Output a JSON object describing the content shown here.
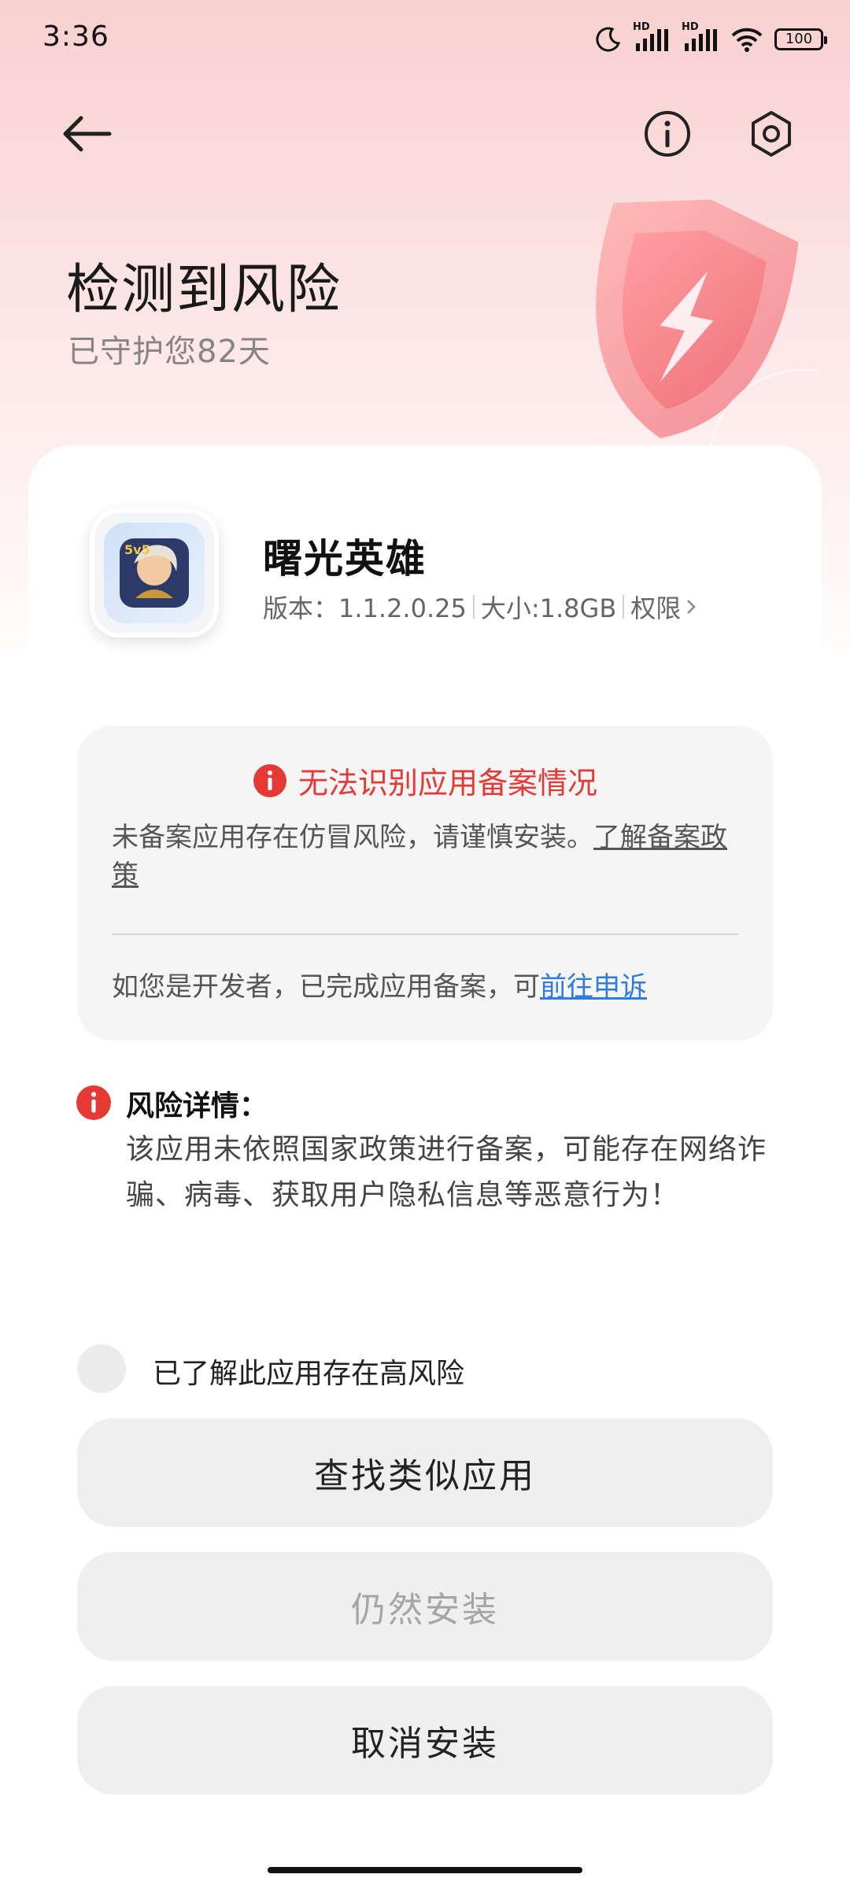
{
  "status_bar": {
    "time": "3:36",
    "network_1": "HD",
    "network_2": "HD",
    "battery": "100",
    "icons": [
      "moon-icon",
      "signal-icon",
      "signal-icon",
      "wifi-icon",
      "battery-icon"
    ]
  },
  "nav": {
    "icons": [
      "back-arrow-icon",
      "info-icon",
      "settings-icon"
    ]
  },
  "header": {
    "title": "检测到风险",
    "subtitle": "已守护您82天"
  },
  "app": {
    "name": "曙光英雄",
    "version": "版本：1.1.2.0.25",
    "size": "大小:1.8GB",
    "permissions": "权限",
    "icon_badge": "5v5"
  },
  "warning": {
    "title": "无法识别应用备案情况",
    "description": "未备案应用存在仿冒风险，请谨慎安装。",
    "policy_link": "了解备案政策",
    "appeal_text": "如您是开发者，已完成应用备案，可",
    "appeal_link": "前往申诉"
  },
  "risk": {
    "label": "风险详情：",
    "text": "该应用未依照国家政策进行备案，可能存在网络诈骗、病毒、获取用户隐私信息等恶意行为！"
  },
  "acknowledge": {
    "label": "已了解此应用存在高风险",
    "checked": false
  },
  "buttons": {
    "find_similar": "查找类似应用",
    "install_anyway": "仍然安装",
    "cancel_install": "取消安装"
  },
  "colors": {
    "danger": "#e53935",
    "link": "#2f7be0",
    "header_bg": "#f9d0d0",
    "button_bg": "#efefef",
    "disabled_text": "#a5a5a5"
  }
}
